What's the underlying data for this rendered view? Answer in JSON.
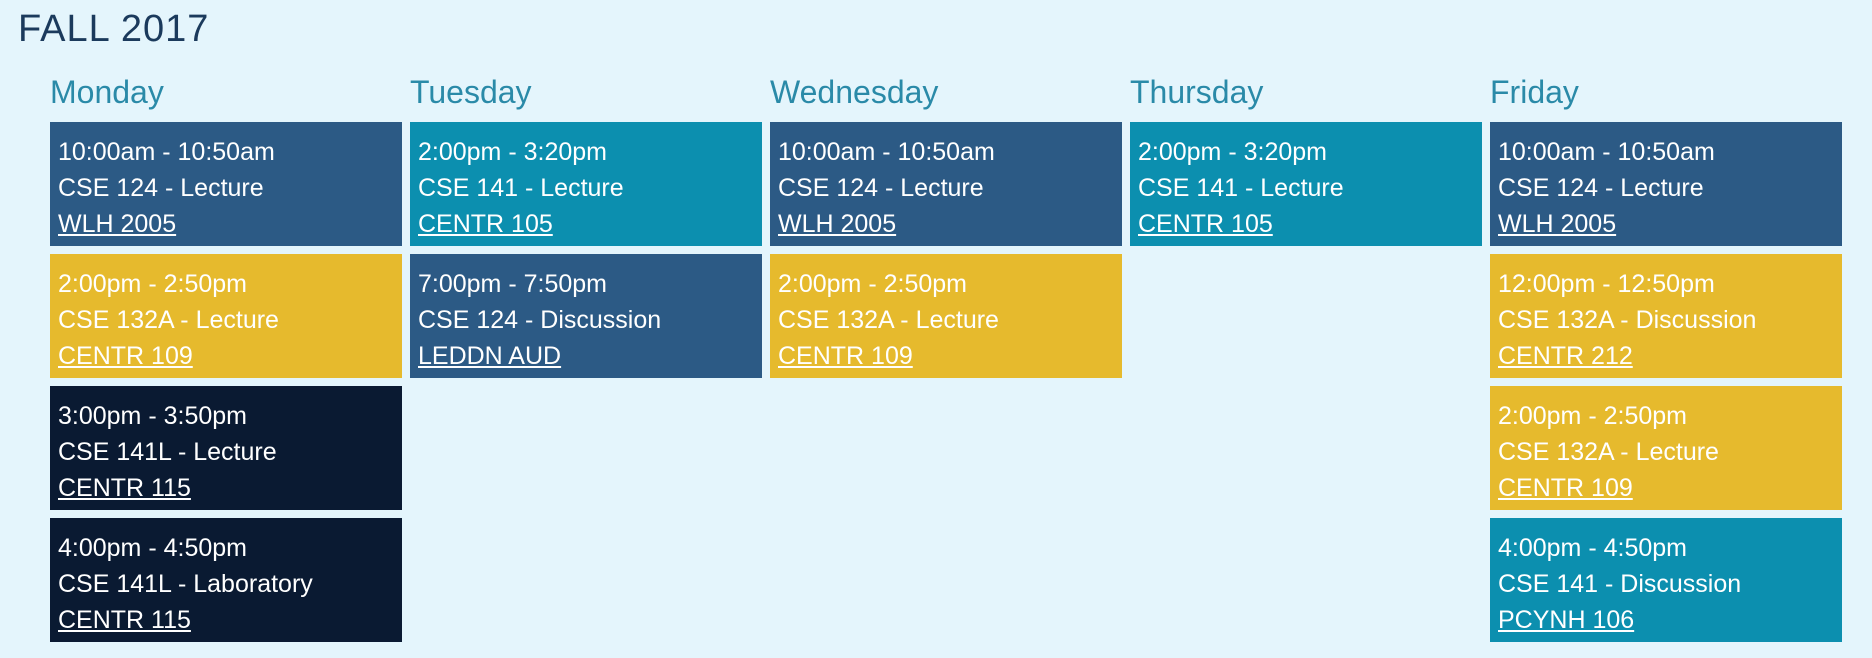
{
  "term": "FALL 2017",
  "colors": {
    "blue": "#2c5a85",
    "teal": "#0c8faf",
    "gold": "#e6ba2d",
    "navy": "#0a1a32",
    "day_heading": "#2a8aa8",
    "background": "#e4f5fc"
  },
  "days": [
    {
      "name": "Monday",
      "events": [
        {
          "time": "10:00am - 10:50am",
          "course": "CSE 124 - Lecture",
          "location": "WLH 2005",
          "color": "blue"
        },
        {
          "time": "2:00pm - 2:50pm",
          "course": "CSE 132A - Lecture",
          "location": "CENTR 109",
          "color": "gold"
        },
        {
          "time": "3:00pm - 3:50pm",
          "course": "CSE 141L - Lecture",
          "location": "CENTR 115",
          "color": "navy"
        },
        {
          "time": "4:00pm - 4:50pm",
          "course": "CSE 141L - Laboratory",
          "location": "CENTR 115",
          "color": "navy"
        }
      ]
    },
    {
      "name": "Tuesday",
      "events": [
        {
          "time": "2:00pm - 3:20pm",
          "course": "CSE 141 - Lecture",
          "location": "CENTR 105",
          "color": "teal"
        },
        {
          "time": "7:00pm - 7:50pm",
          "course": "CSE 124 - Discussion",
          "location": "LEDDN AUD",
          "color": "blue"
        }
      ]
    },
    {
      "name": "Wednesday",
      "events": [
        {
          "time": "10:00am - 10:50am",
          "course": "CSE 124 - Lecture",
          "location": "WLH 2005",
          "color": "blue"
        },
        {
          "time": "2:00pm - 2:50pm",
          "course": "CSE 132A - Lecture",
          "location": "CENTR 109",
          "color": "gold"
        }
      ]
    },
    {
      "name": "Thursday",
      "events": [
        {
          "time": "2:00pm - 3:20pm",
          "course": "CSE 141 - Lecture",
          "location": "CENTR 105",
          "color": "teal"
        }
      ]
    },
    {
      "name": "Friday",
      "events": [
        {
          "time": "10:00am - 10:50am",
          "course": "CSE 124 - Lecture",
          "location": "WLH 2005",
          "color": "blue"
        },
        {
          "time": "12:00pm - 12:50pm",
          "course": "CSE 132A - Discussion",
          "location": "CENTR 212",
          "color": "gold"
        },
        {
          "time": "2:00pm - 2:50pm",
          "course": "CSE 132A - Lecture",
          "location": "CENTR 109",
          "color": "gold"
        },
        {
          "time": "4:00pm - 4:50pm",
          "course": "CSE 141 - Discussion",
          "location": "PCYNH 106",
          "color": "teal"
        }
      ]
    }
  ]
}
